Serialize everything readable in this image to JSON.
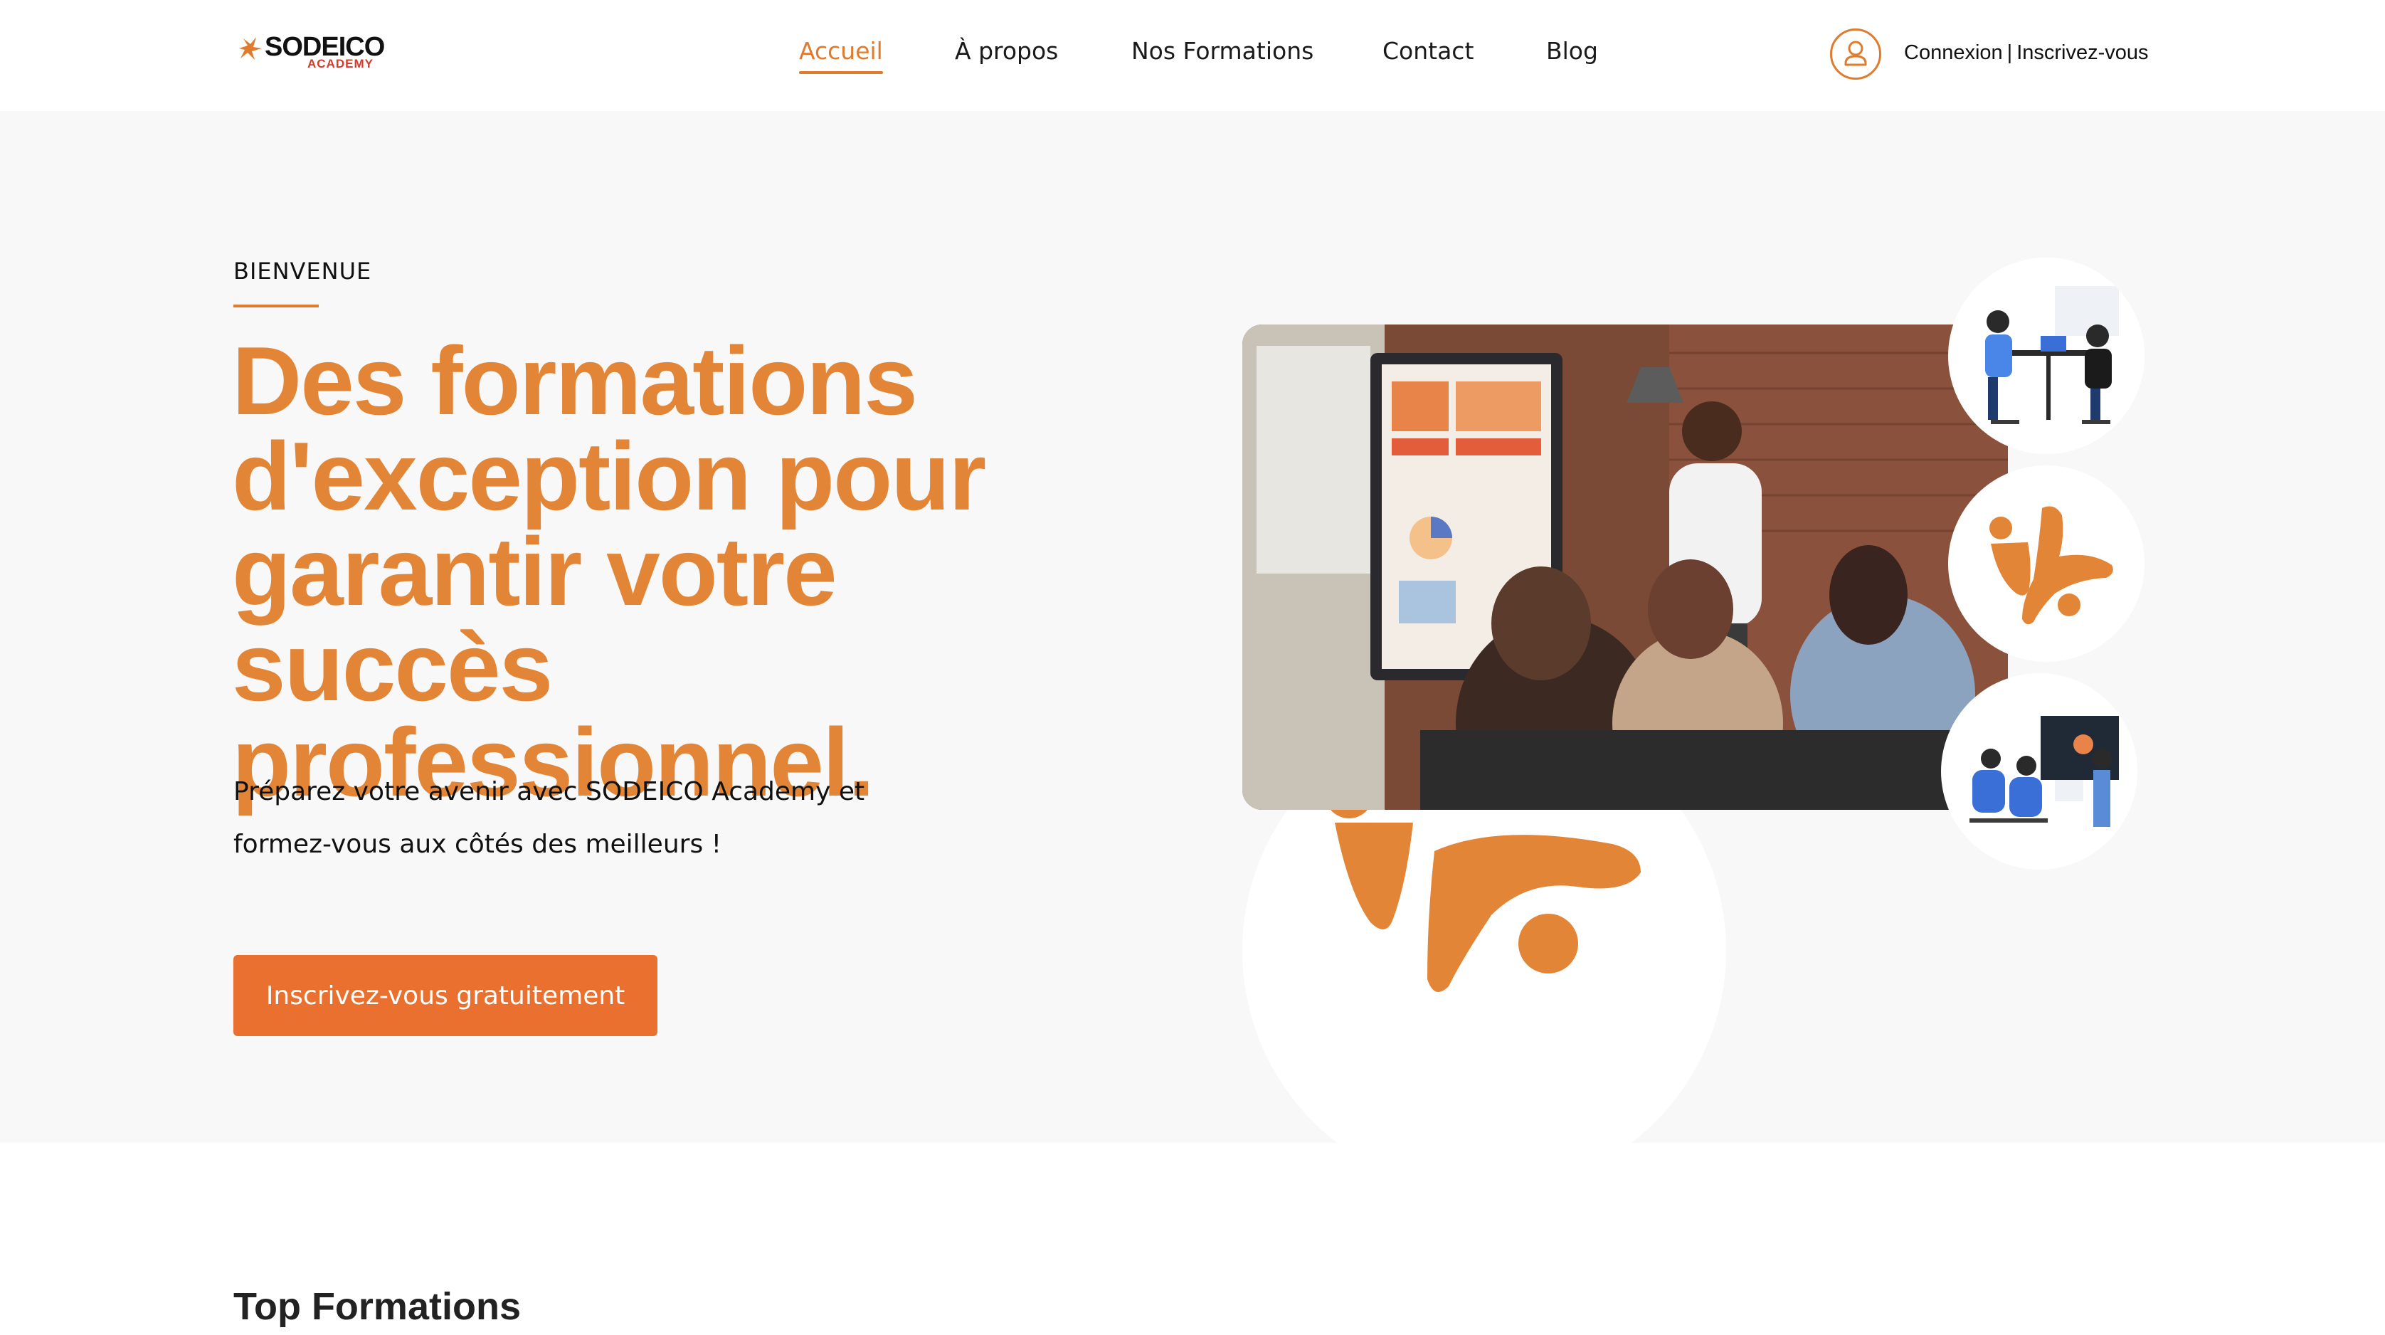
{
  "brand": {
    "name": "SODEICO",
    "sub": "ACADEMY",
    "accent": "#e07b2e",
    "button_color": "#e9702f"
  },
  "nav": {
    "items": [
      {
        "label": "Accueil",
        "active": true
      },
      {
        "label": "À propos",
        "active": false
      },
      {
        "label": "Nos Formations",
        "active": false
      },
      {
        "label": "Contact",
        "active": false
      },
      {
        "label": "Blog",
        "active": false
      }
    ]
  },
  "auth": {
    "icon": "user-icon",
    "login_label": "Connexion",
    "separator": "|",
    "signup_label": "Inscrivez-vous"
  },
  "hero": {
    "kicker": "BIENVENUE",
    "title": "Des formations d'exception pour garantir votre succès professionnel.",
    "description": "Préparez votre avenir avec SODEICO Academy et formez-vous aux côtés des meilleurs !",
    "cta_label": "Inscrivez-vous gratuitement"
  },
  "sections": {
    "top_formations_title": "Top Formations"
  }
}
